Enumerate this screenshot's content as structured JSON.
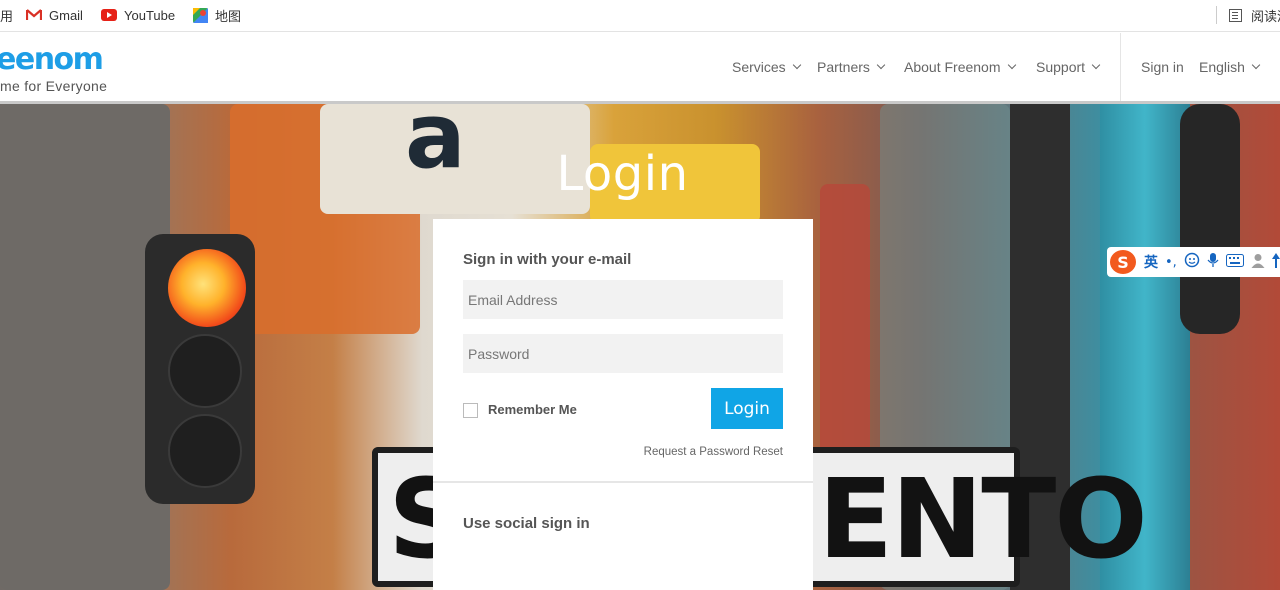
{
  "bookmarks": {
    "items": [
      {
        "label": "用",
        "icon": "apps-icon"
      },
      {
        "label": "Gmail",
        "icon": "gmail-icon"
      },
      {
        "label": "YouTube",
        "icon": "youtube-icon"
      },
      {
        "label": "地图",
        "icon": "maps-icon"
      }
    ],
    "reading_list_label": "阅读清"
  },
  "header": {
    "logo_text": "eenom",
    "tagline": "me for Everyone",
    "nav": [
      "Services",
      "Partners",
      "About Freenom",
      "Support"
    ],
    "sign_in": "Sign in",
    "language": "English"
  },
  "hero": {
    "title": "Login",
    "sign_left": "S",
    "sign_right": "ENTO",
    "store_letter": "a"
  },
  "login_card": {
    "email_heading": "Sign in with your e-mail",
    "email_placeholder": "Email Address",
    "password_placeholder": "Password",
    "remember_label": "Remember Me",
    "login_button": "Login",
    "reset_link": "Request a Password Reset",
    "social_heading": "Use social sign in"
  },
  "ime_toolbar": {
    "logo": "S",
    "mode": "英",
    "punct": "•,",
    "icons": [
      "emoji-icon",
      "microphone-icon",
      "keyboard-icon",
      "user-icon",
      "skin-icon"
    ]
  },
  "colors": {
    "brand_blue": "#1e9ee6",
    "button_blue": "#10a5e6",
    "ime_orange": "#f25a1e"
  }
}
